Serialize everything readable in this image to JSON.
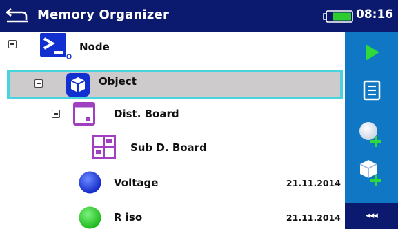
{
  "header": {
    "title": "Memory Organizer",
    "time": "08:16",
    "bg_color": "#0b1a6e"
  },
  "tree": {
    "items": [
      {
        "label": "Node",
        "icon": "node-icon",
        "expanded": true,
        "date": ""
      },
      {
        "label": "Object",
        "icon": "object-icon",
        "expanded": true,
        "selected": true,
        "date": ""
      },
      {
        "label": "Dist. Board",
        "icon": "dist-board-icon",
        "expanded": true,
        "date": ""
      },
      {
        "label": "Sub D. Board",
        "icon": "sub-board-icon",
        "date": ""
      },
      {
        "label": "Voltage",
        "icon": "blue-circle-icon",
        "date": "21.11.2014"
      },
      {
        "label": "R iso",
        "icon": "green-circle-icon",
        "date": "21.11.2014"
      }
    ],
    "selection_color": "#49d3df"
  },
  "toolbar": {
    "bg_color": "#0f77c3",
    "buttons": [
      "play-icon",
      "list-icon",
      "add-measurement-icon",
      "add-structure-icon"
    ],
    "collapse_label": "◂◂◂"
  }
}
